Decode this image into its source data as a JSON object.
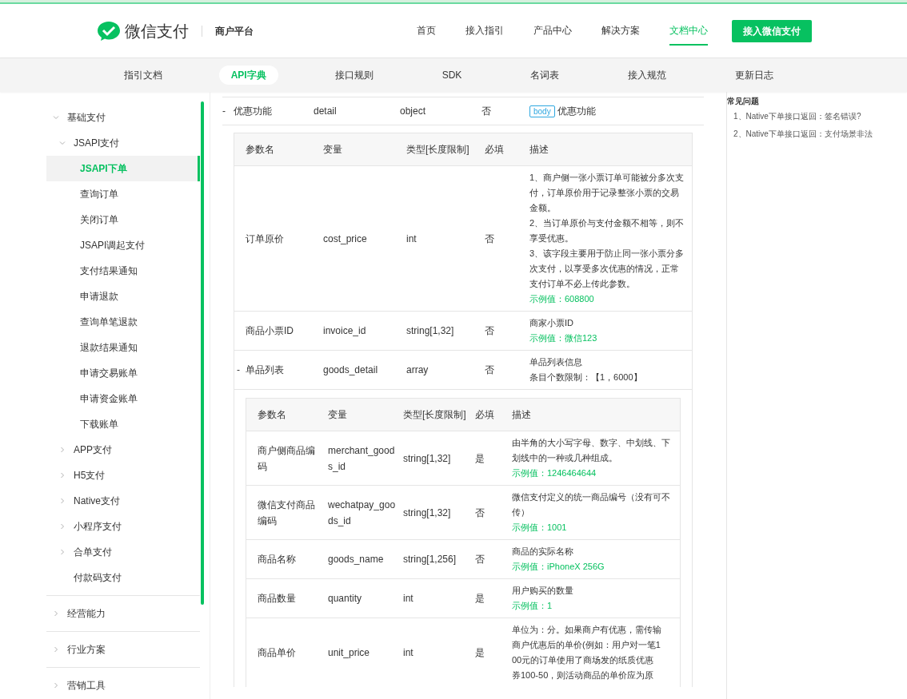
{
  "header": {
    "brand": "微信支付",
    "subtitle": "商户平台",
    "nav": [
      {
        "label": "首页",
        "selected": false
      },
      {
        "label": "接入指引",
        "selected": false
      },
      {
        "label": "产品中心",
        "selected": false
      },
      {
        "label": "解决方案",
        "selected": false
      },
      {
        "label": "文档中心",
        "selected": true
      }
    ],
    "cta": "接入微信支付"
  },
  "subnav": [
    {
      "label": "指引文档",
      "selected": false
    },
    {
      "label": "API字典",
      "selected": true
    },
    {
      "label": "接口规则",
      "selected": false
    },
    {
      "label": "SDK",
      "selected": false
    },
    {
      "label": "名词表",
      "selected": false
    },
    {
      "label": "接入规范",
      "selected": false
    },
    {
      "label": "更新日志",
      "selected": false
    }
  ],
  "sidebar": [
    {
      "label": "基础支付",
      "expanded": true,
      "selected": false,
      "children": [
        {
          "label": "JSAPI支付",
          "expanded": true,
          "selected": false,
          "children": [
            {
              "label": "JSAPI下单",
              "selected": true
            },
            {
              "label": "查询订单",
              "selected": false
            },
            {
              "label": "关闭订单",
              "selected": false
            },
            {
              "label": "JSAPI调起支付",
              "selected": false
            },
            {
              "label": "支付结果通知",
              "selected": false
            },
            {
              "label": "申请退款",
              "selected": false
            },
            {
              "label": "查询单笔退款",
              "selected": false
            },
            {
              "label": "退款结果通知",
              "selected": false
            },
            {
              "label": "申请交易账单",
              "selected": false
            },
            {
              "label": "申请资金账单",
              "selected": false
            },
            {
              "label": "下载账单",
              "selected": false
            }
          ]
        },
        {
          "label": "APP支付",
          "expanded": false,
          "selected": false
        },
        {
          "label": "H5支付",
          "expanded": false,
          "selected": false
        },
        {
          "label": "Native支付",
          "expanded": false,
          "selected": false
        },
        {
          "label": "小程序支付",
          "expanded": false,
          "selected": false
        },
        {
          "label": "合单支付",
          "expanded": false,
          "selected": false
        },
        {
          "label": "付款码支付",
          "selected": false
        }
      ]
    },
    {
      "label": "经营能力",
      "expanded": false,
      "selected": false
    },
    {
      "label": "行业方案",
      "expanded": false,
      "selected": false
    },
    {
      "label": "营销工具",
      "expanded": false,
      "selected": false
    }
  ],
  "content": {
    "top_row": {
      "toggle": "-",
      "name": "优惠功能",
      "variable": "detail",
      "type": "object",
      "required": "否",
      "tag": "body",
      "description": "优惠功能"
    },
    "sub_table": {
      "columns": [
        "参数名",
        "变量",
        "类型[长度限制]",
        "必填",
        "描述"
      ],
      "rows": [
        {
          "name": "订单原价",
          "variable": "cost_price",
          "type": "int",
          "required": "否",
          "description": [
            "1、商户侧一张小票订单可能被分多次支付，订单原价用于记录整张小票的交易金额。",
            "2、当订单原价与支付金额不相等，则不享受优惠。",
            "3、该字段主要用于防止同一张小票分多次支付，以享受多次优惠的情况，正常支付订单不必上传此参数。"
          ],
          "example": "示例值：608800"
        },
        {
          "name": "商品小票ID",
          "variable": "invoice_id",
          "type": "string[1,32]",
          "required": "否",
          "description": [
            "商家小票ID"
          ],
          "example": "示例值：微信123"
        },
        {
          "toggle": "-",
          "name": "单品列表",
          "variable": "goods_detail",
          "type": "array",
          "required": "否",
          "description": [
            "单品列表信息",
            "条目个数限制：【1，6000】"
          ]
        }
      ],
      "nested_table": {
        "columns": [
          "参数名",
          "变量",
          "类型[长度限制]",
          "必填",
          "描述"
        ],
        "rows": [
          {
            "name": "商户侧商品编码",
            "variable": "merchant_goods_id",
            "type": "string[1,32]",
            "required": "是",
            "description": [
              "由半角的大小写字母、数字、中划线、下划线中的一种或几种组成。"
            ],
            "example": "示例值：1246464644"
          },
          {
            "name": "微信支付商品编码",
            "variable": "wechatpay_goods_id",
            "type": "string[1,32]",
            "required": "否",
            "description": [
              "微信支付定义的统一商品编号（没有可不传）"
            ],
            "example": "示例值：1001"
          },
          {
            "name": "商品名称",
            "variable": "goods_name",
            "type": "string[1,256]",
            "required": "否",
            "description": [
              "商品的实际名称"
            ],
            "example": "示例值：iPhoneX 256G"
          },
          {
            "name": "商品数量",
            "variable": "quantity",
            "type": "int",
            "required": "是",
            "description": [
              "用户购买的数量"
            ],
            "example": "示例值：1"
          },
          {
            "name": "商品单价",
            "variable": "unit_price",
            "type": "int",
            "required": "是",
            "description": [
              "单位为：分。如果商户有优惠，需传输",
              "商户优惠后的单价(例如：用户对一笔1",
              "00元的订单使用了商场发的纸质优惠",
              "券100-50，则活动商品的单价应为原"
            ]
          }
        ]
      }
    }
  },
  "faq": {
    "title": "常见问题",
    "items": [
      "1、Native下单接口返回：签名错误?",
      "2、Native下单接口返回：支付场景非法"
    ]
  }
}
